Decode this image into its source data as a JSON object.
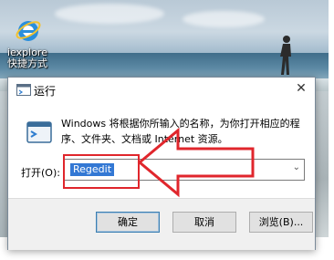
{
  "desktop": {
    "icon_label_line1": "iexplore",
    "icon_label_line2": "快捷方式"
  },
  "dialog": {
    "title": "运行",
    "close_glyph": "✕",
    "description": "Windows 将根据你所输入的名称，为你打开相应的程序、文件夹、文档或 Internet 资源。",
    "open_label": "打开(O):",
    "input_value": "Regedit",
    "dropdown_glyph": "⌄",
    "buttons": {
      "ok": "确定",
      "cancel": "取消",
      "browse": "浏览(B)..."
    }
  },
  "annotation_colors": {
    "highlight_box": "#e0262c",
    "arrow": "#e0262c"
  }
}
